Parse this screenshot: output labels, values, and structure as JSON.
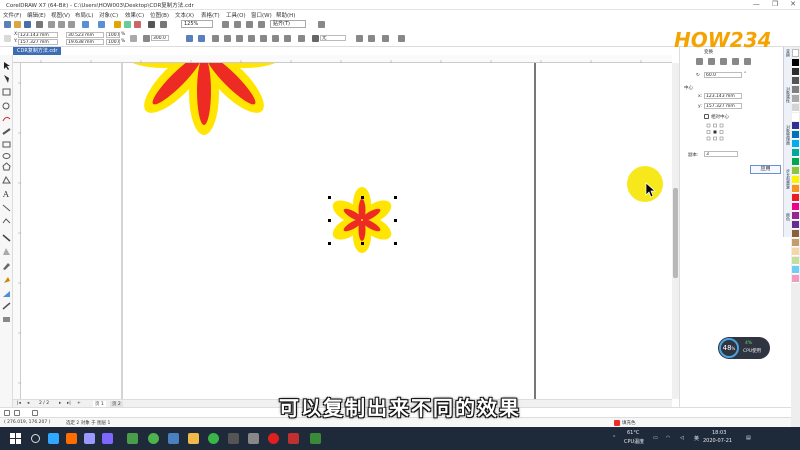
{
  "window": {
    "title": "CorelDRAW X7 (64-Bit) - C:\\Users\\HOW003\\Desktop\\CDR复制方法.cdr",
    "controls": [
      "—",
      "❐",
      "✕"
    ]
  },
  "menu": [
    "文件(F)",
    "编辑(E)",
    "视图(V)",
    "布局(L)",
    "对象(C)",
    "效果(C)",
    "位图(B)",
    "文本(X)",
    "表格(T)",
    "工具(O)",
    "窗口(W)",
    "帮助(H)"
  ],
  "toolbar": {
    "zoom": "125%",
    "snap": "贴齐(T)"
  },
  "property_bar": {
    "x": "123.143 mm",
    "y": "157.327 mm",
    "w": "30.523 mm",
    "h": "19.638 mm",
    "sx": "100.0",
    "sy": "100.0",
    "pct": "%",
    "angle": "300.0",
    "outline": "无"
  },
  "document_tab": "CDR复制方法.cdr",
  "docker": {
    "title": "变换",
    "angle_value": "60.0",
    "angle_unit": "°",
    "center_label": "中心",
    "x_label": "x:",
    "x_value": "123.143 mm",
    "y_label": "y:",
    "y_value": "157.327 mm",
    "relative_center": "相对中心",
    "copies_label": "副本:",
    "copies_value": "3",
    "apply": "应用"
  },
  "docker_tabs": [
    "变换",
    "对象属性",
    "对象管理器",
    "步长和重复",
    "颜色"
  ],
  "page_nav": {
    "counter": "2 / 2",
    "page1": "页 1",
    "page2": "页 2"
  },
  "status": {
    "coords": "( 276.019, 176.207 )",
    "selection": "选定 2 对象 于 图层 1",
    "fill_label": "填充色"
  },
  "subtitle": "可以复制出来不同的效果",
  "watermark": "HOW234",
  "cpu": {
    "percent": "48",
    "percent_sign": "%",
    "small": "4%",
    "label": "CPU使用"
  },
  "tray": {
    "temp": "61°C",
    "temp_label": "CPU温度",
    "lang": "英",
    "time": "18:03",
    "date": "2020-07-21"
  },
  "colors": {
    "flower_outer": "#ffe500",
    "flower_inner": "#ee2a24",
    "accent": "#3b6cb4",
    "cursor_highlight": "#f7e81c"
  }
}
